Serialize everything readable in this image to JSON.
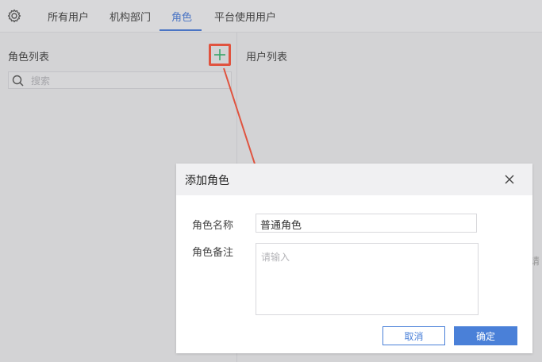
{
  "tabs": [
    {
      "label": "所有用户",
      "active": false
    },
    {
      "label": "机构部门",
      "active": false
    },
    {
      "label": "角色",
      "active": true
    },
    {
      "label": "平台使用用户",
      "active": false
    }
  ],
  "left_panel": {
    "title": "角色列表",
    "search_placeholder": "搜索"
  },
  "right_panel": {
    "title": "用户列表",
    "cut_text": "请"
  },
  "dialog": {
    "title": "添加角色",
    "name_label": "角色名称",
    "name_value": "普通角色",
    "note_label": "角色备注",
    "note_placeholder": "请输入",
    "cancel_label": "取消",
    "ok_label": "确定"
  },
  "colors": {
    "accent": "#4a80d8",
    "highlight": "#e0533f",
    "add_icon": "#3aa66a"
  },
  "icons": [
    "gear-icon",
    "plus-icon",
    "search-icon",
    "close-icon"
  ]
}
